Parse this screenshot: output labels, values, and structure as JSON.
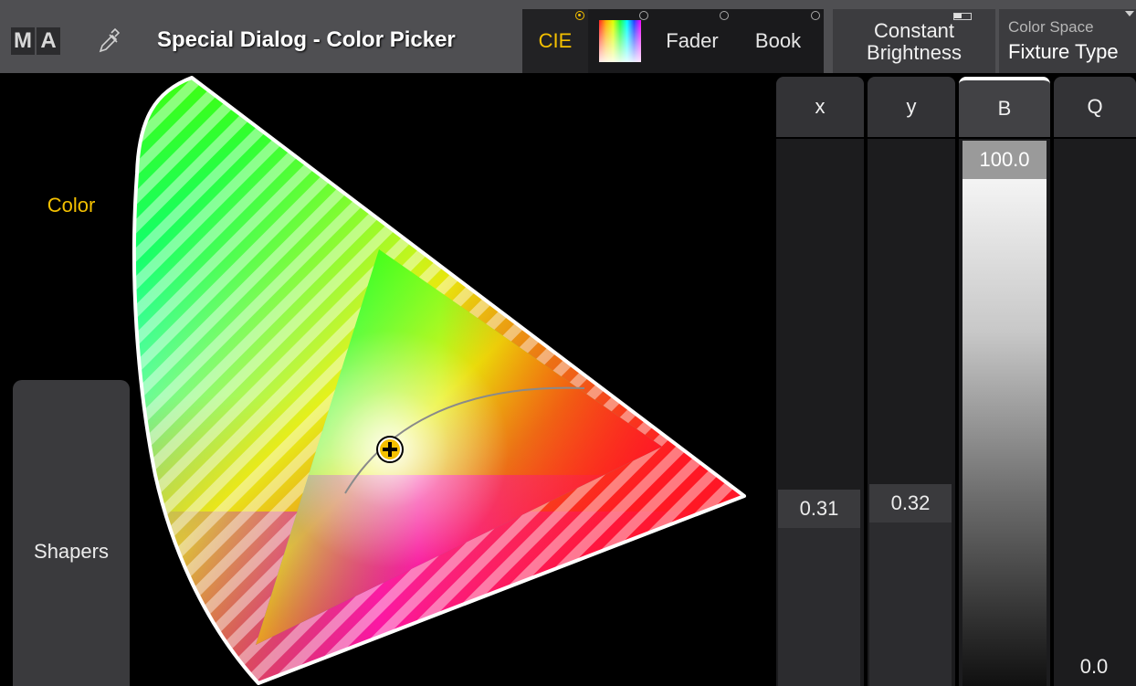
{
  "titlebar": {
    "logo_letters": [
      "M",
      "A"
    ],
    "pipette_icon": "pipette-icon",
    "title": "Special Dialog - Color Picker"
  },
  "tabs": [
    {
      "label": "CIE",
      "active": true
    },
    {
      "label": "",
      "icon": "color-swatch-icon",
      "active": false
    },
    {
      "label": "Fader",
      "active": false
    },
    {
      "label": "Book",
      "active": false
    }
  ],
  "buttons": {
    "brightness_line1": "Constant",
    "brightness_line2": "Brightness",
    "colorspace_label": "Color Space",
    "colorspace_value": "Fixture Type"
  },
  "sidebar": {
    "color_label": "Color",
    "shapers_label": "Shapers"
  },
  "faders": {
    "x": {
      "label": "x",
      "value": "0.31"
    },
    "y": {
      "label": "y",
      "value": "0.32"
    },
    "b": {
      "label": "B",
      "value": "100.0"
    },
    "q": {
      "label": "Q",
      "value": "0.0"
    }
  },
  "colors": {
    "accent": "#f4c000",
    "titlebar": "#4f4f52",
    "panel": "#3a3a3d"
  }
}
